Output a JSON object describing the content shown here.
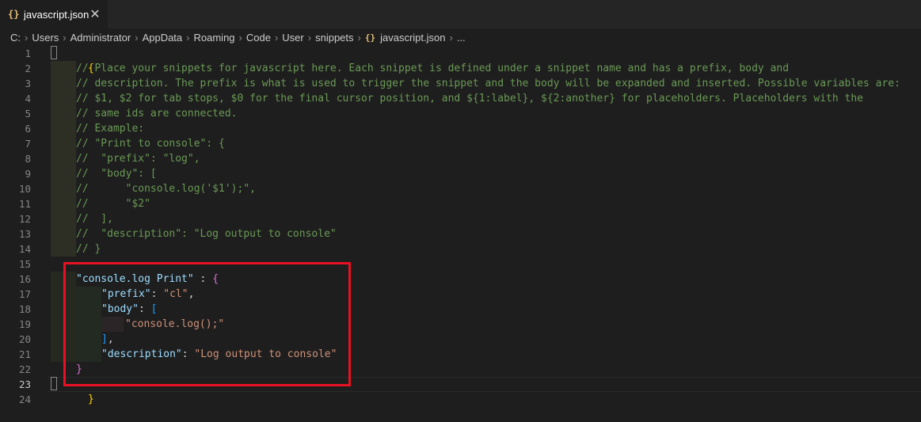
{
  "tab": {
    "icon": "{}",
    "label": "javascript.json",
    "close_glyph": "✕"
  },
  "breadcrumb": {
    "items": [
      "C:",
      "Users",
      "Administrator",
      "AppData",
      "Roaming",
      "Code",
      "User",
      "snippets"
    ],
    "file_icon": "{}",
    "file": "javascript.json",
    "tail": "..."
  },
  "editor": {
    "active_line": 23,
    "line_numbers": [
      "1",
      "2",
      "3",
      "4",
      "5",
      "6",
      "7",
      "8",
      "9",
      "10",
      "11",
      "12",
      "13",
      "14",
      "15",
      "16",
      "17",
      "18",
      "19",
      "20",
      "21",
      "22",
      "23",
      "24"
    ],
    "comments": [
      "// Place your snippets for javascript here. Each snippet is defined under a snippet name and has a prefix, body and",
      "// description. The prefix is what is used to trigger the snippet and the body will be expanded and inserted. Possible variables are:",
      "// $1, $2 for tab stops, $0 for the final cursor position, and ${1:label}, ${2:another} for placeholders. Placeholders with the",
      "// same ids are connected.",
      "// Example:",
      "// \"Print to console\": {",
      "//  \"prefix\": \"log\",",
      "//  \"body\": [",
      "//      \"console.log('$1');\",",
      "//      \"$2\"",
      "//  ],",
      "//  \"description\": \"Log output to console\"",
      "// }"
    ],
    "snippet": {
      "name": "\"console.log Print\"",
      "prefix_key": "\"prefix\"",
      "prefix_value": "\"cl\"",
      "body_key": "\"body\"",
      "body_item": "\"console.log();\"",
      "description_key": "\"description\"",
      "description_value": "\"Log output to console\""
    },
    "open_brace": "{",
    "close_brace": "}",
    "inner_close_brace": "}",
    "open_bracket": "[",
    "close_bracket": "]"
  },
  "colors": {
    "comment": "#6a9955",
    "key": "#9cdcfe",
    "string": "#ce9178",
    "bracket_level1": "#ffd700",
    "bracket_level2": "#da70d6",
    "bracket_level3": "#179fff",
    "highlight_box": "#e81123"
  }
}
